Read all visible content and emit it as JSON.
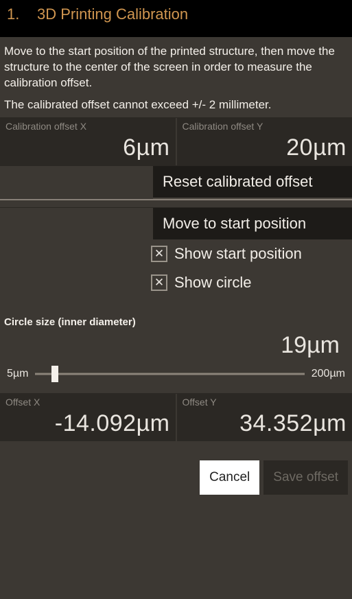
{
  "header": {
    "number": "1.",
    "title": "3D Printing Calibration"
  },
  "instruction": "Move to the start position of the printed structure, then move the structure to the center of the screen in order to measure the calibration offset.",
  "note": "The calibrated offset cannot exceed +/- 2 millimeter.",
  "calibration": {
    "x_label": "Calibration offset X",
    "x_value": "6µm",
    "y_label": "Calibration offset Y",
    "y_value": "20µm"
  },
  "buttons": {
    "reset": "Reset calibrated offset",
    "move_start": "Move to start position"
  },
  "checks": {
    "show_start": {
      "label": "Show start position",
      "checked": true
    },
    "show_circle": {
      "label": "Show circle",
      "checked": true
    }
  },
  "circle": {
    "label": "Circle size (inner diameter)",
    "value": "19µm",
    "min_label": "5µm",
    "max_label": "200µm",
    "min": 5,
    "max": 200,
    "current": 19
  },
  "offset": {
    "x_label": "Offset X",
    "x_value": "-14.092µm",
    "y_label": "Offset Y",
    "y_value": "34.352µm"
  },
  "footer": {
    "cancel": "Cancel",
    "save": "Save offset"
  }
}
